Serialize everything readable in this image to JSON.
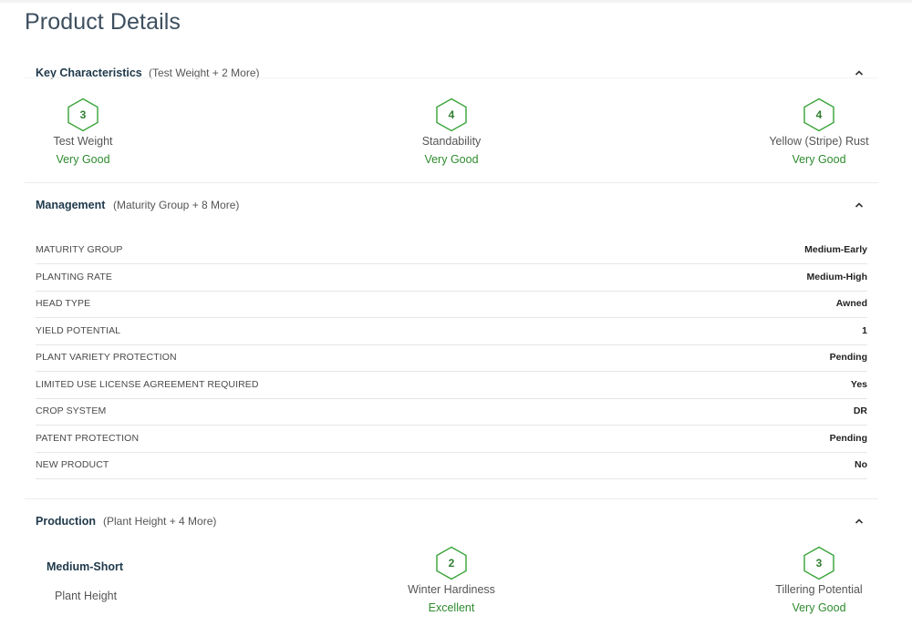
{
  "page_title": "Product Details",
  "colors": {
    "accent_green": "#2e8b2e",
    "heading_navy": "#203a4c"
  },
  "key_characteristics": {
    "title": "Key Characteristics",
    "subtitle": "(Test Weight + 2 More)",
    "toggle_icon": "chevron-up-icon",
    "items": [
      {
        "score": "3",
        "label": "Test Weight",
        "rating": "Very Good"
      },
      {
        "score": "4",
        "label": "Standability",
        "rating": "Very Good"
      },
      {
        "score": "4",
        "label": "Yellow (Stripe) Rust",
        "rating": "Very Good"
      }
    ]
  },
  "management": {
    "title": "Management",
    "subtitle": "(Maturity Group + 8 More)",
    "toggle_icon": "chevron-up-icon",
    "rows": [
      {
        "key": "MATURITY GROUP",
        "value": "Medium-Early"
      },
      {
        "key": "PLANTING RATE",
        "value": "Medium-High"
      },
      {
        "key": "HEAD TYPE",
        "value": "Awned"
      },
      {
        "key": "YIELD POTENTIAL",
        "value": "1"
      },
      {
        "key": "PLANT VARIETY PROTECTION",
        "value": "Pending"
      },
      {
        "key": "LIMITED USE LICENSE AGREEMENT REQUIRED",
        "value": "Yes"
      },
      {
        "key": "CROP SYSTEM",
        "value": "DR"
      },
      {
        "key": "PATENT PROTECTION",
        "value": "Pending"
      },
      {
        "key": "NEW PRODUCT",
        "value": "No"
      }
    ]
  },
  "production": {
    "title": "Production",
    "subtitle": "(Plant Height + 4 More)",
    "toggle_icon": "chevron-up-icon",
    "plant_height": {
      "value": "Medium-Short",
      "label": "Plant Height"
    },
    "items": [
      {
        "score": "2",
        "label": "Winter Hardiness",
        "rating": "Excellent"
      },
      {
        "score": "3",
        "label": "Tillering Potential",
        "rating": "Very Good"
      }
    ]
  }
}
